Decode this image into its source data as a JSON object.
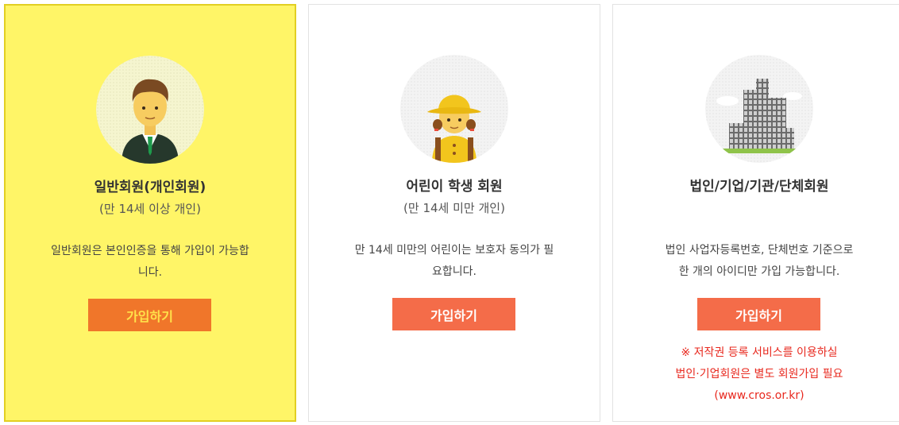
{
  "cards": [
    {
      "id": "general",
      "selected": true,
      "icon": "businessman-icon",
      "title": "일반회원(개인회원)",
      "subtitle": "(만 14세 이상 개인)",
      "desc_lines": [
        "일반회원은 본인인증을 통해 가입이 가능합",
        "니다."
      ],
      "button": "가입하기"
    },
    {
      "id": "child",
      "selected": false,
      "icon": "student-child-icon",
      "title": "어린이 학생 회원",
      "subtitle": "(만 14세 미만 개인)",
      "desc_lines": [
        "만 14세 미만의 어린이는 보호자 동의가 필",
        "요합니다."
      ],
      "button": "가입하기"
    },
    {
      "id": "corporate",
      "selected": false,
      "icon": "buildings-icon",
      "title": "법인/기업/기관/단체회원",
      "subtitle": "",
      "desc_lines": [
        "법인 사업자등록번호, 단체번호 기준으로",
        "한 개의 아이디만 가입 가능합니다."
      ],
      "button": "가입하기",
      "notice_lines": [
        "※ 저작권 등록 서비스를 이용하실",
        "법인·기업회원은 별도 회원가입 필요",
        "(www.cros.or.kr)"
      ]
    }
  ],
  "colors": {
    "selected_bg": "#fff567",
    "button_bg": "#f46c49",
    "notice_text": "#e8281e"
  }
}
